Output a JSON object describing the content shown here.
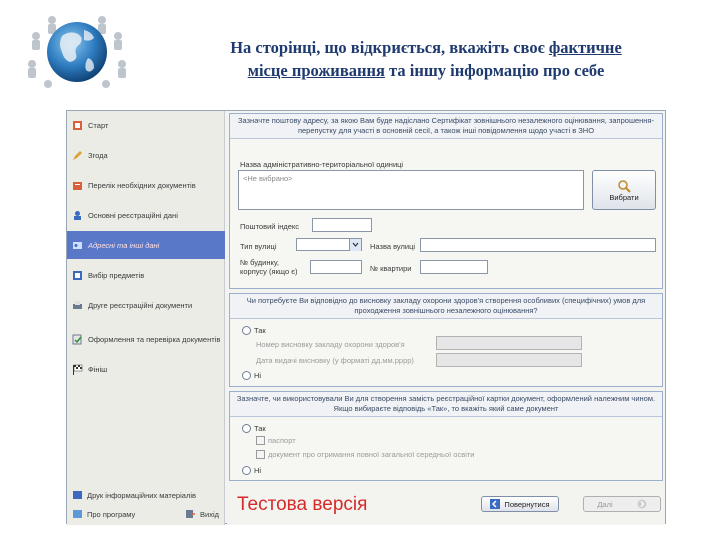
{
  "slide": {
    "title_part1": "На сторінці, що відкриється, вкажіть своє ",
    "title_underline1": "фактичне",
    "title_underline2": "місце проживання",
    "title_part2": " та іншу інформацію про себе"
  },
  "sidebar": {
    "items": [
      {
        "label": "Старт",
        "icon": "start-icon"
      },
      {
        "label": "Згода",
        "icon": "pencil-icon"
      },
      {
        "label": "Перелік необхідних документів",
        "icon": "documents-icon"
      },
      {
        "label": "Основні реєстраційні дані",
        "icon": "user-data-icon"
      },
      {
        "label": "Адресні та інші дані",
        "icon": "address-icon",
        "active": true
      },
      {
        "label": "Вибір предметів",
        "icon": "subjects-icon"
      },
      {
        "label": "Друге реєстраційні документи",
        "icon": "print-icon"
      },
      {
        "label": "Оформлення та перевірка документів",
        "icon": "check-doc-icon"
      },
      {
        "label": "Фініш",
        "icon": "finish-flag-icon"
      }
    ],
    "bottom_links": [
      {
        "label": "Друк інформаційних матеріалів",
        "icon": "info-materials-icon"
      },
      {
        "label": "Про програму",
        "icon": "about-icon"
      },
      {
        "label": "Вихід",
        "icon": "exit-icon"
      }
    ]
  },
  "address_panel": {
    "header": "Зазначте поштову адресу, за якою Вам буде надіслано Сертифікат зовнішнього незалежного оцінювання, запрошення-перепустку для участі в основній сесії, а також інші повідомлення щодо участі в ЗНО",
    "territorial_label": "Назва адміністративно-територіальної одиниці",
    "territorial_placeholder": "<Не вибрано>",
    "choose_button": "Вибрати",
    "postal_code_label": "Поштовий індекс",
    "street_type_label": "Тип вулиці",
    "street_name_label": "Назва вулиці",
    "building_label": "№ будинку, корпусу (якщо є)",
    "apartment_label": "№ квартири"
  },
  "special_conditions_panel": {
    "header": "Чи потребуєте Ви відповідно до висновку закладу охорони здоров'я створення особливих (специфічних) умов для проходження зовнішнього незалежного оцінювання?",
    "yes_label": "Так",
    "medical_label": "Номер висновку закладу охорони здоров'я",
    "date_label": "Дата видачі висновку (у форматі дд.мм.рррр)",
    "no_label": "Ні"
  },
  "document_panel": {
    "header": "Зазначте, чи використовували Ви для створення замість реєстраційної картки документ, оформлений належним чином. Якщо вибираєте відповідь «Так», то вкажіть який саме документ",
    "yes_label": "Так",
    "option1": "паспорт",
    "option2": "документ про отримання повної загальної середньої освіти",
    "no_label": "Ні"
  },
  "footer": {
    "test_version": "Тестова версія",
    "back_button": "Повернутися",
    "next_button": "Далі"
  },
  "colors": {
    "title": "#1e3a6e",
    "active_item": "#5a78c8",
    "test_version": "#d62a2a"
  }
}
